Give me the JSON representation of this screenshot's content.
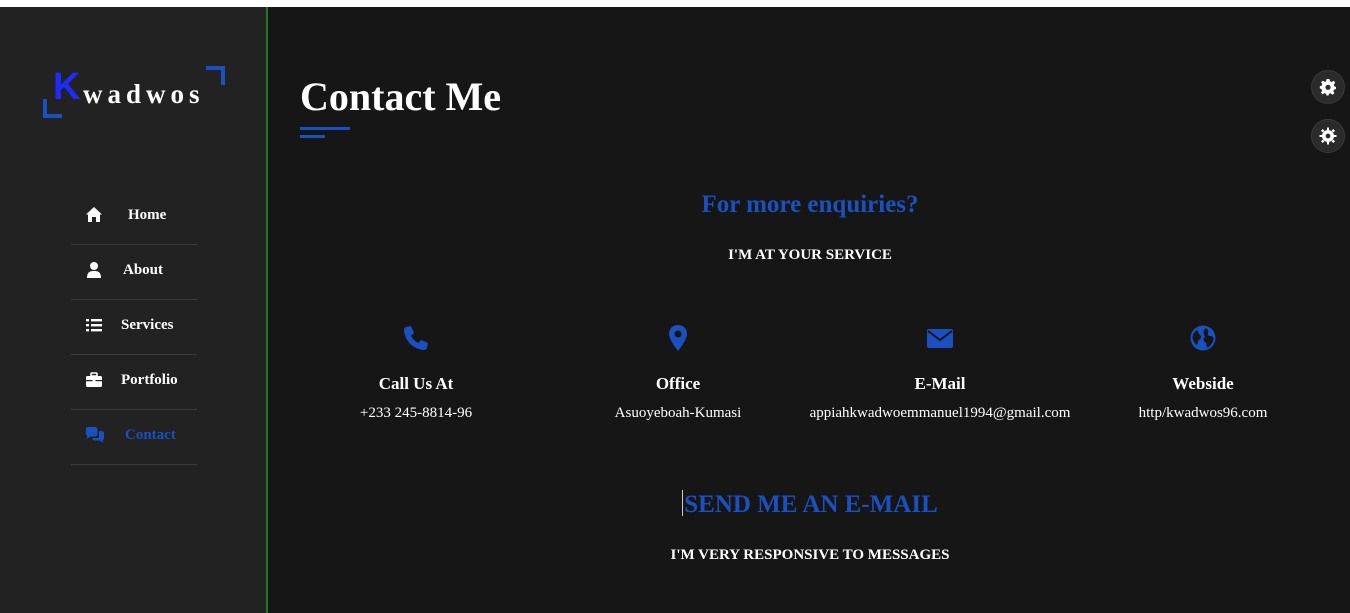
{
  "brand": {
    "first_letter": "K",
    "rest": "wadwos"
  },
  "nav": {
    "items": [
      {
        "label": "Home",
        "icon": "home-icon"
      },
      {
        "label": "About",
        "icon": "user-icon"
      },
      {
        "label": "Services",
        "icon": "list-icon"
      },
      {
        "label": "Portfolio",
        "icon": "briefcase-icon"
      },
      {
        "label": "Contact",
        "icon": "comments-icon",
        "active": true
      }
    ]
  },
  "page": {
    "title": "Contact Me",
    "enquiry_title": "For more enquiries?",
    "enquiry_subtitle": "I'M AT YOUR SERVICE",
    "send_title": "SEND ME AN E-MAIL",
    "send_subtitle": "I'M VERY RESPONSIVE TO MESSAGES"
  },
  "contact_info": [
    {
      "icon": "phone-icon",
      "title": "Call Us At",
      "value": "+233 245-8814-96"
    },
    {
      "icon": "map-pin-icon",
      "title": "Office",
      "value": "Asuoyeboah-Kumasi"
    },
    {
      "icon": "envelope-icon",
      "title": "E-Mail",
      "value": "appiahkwadwoemmanuel1994@gmail.com"
    },
    {
      "icon": "globe-icon",
      "title": "Webside",
      "value": "http/kwadwos96.com"
    }
  ],
  "colors": {
    "accent": "#1a50c0",
    "background": "#161616",
    "sidebar": "#222222",
    "sidebar_border": "#1f7a1f",
    "logo_k": "#1e2bff"
  },
  "settings_buttons": [
    "gear-icon",
    "cog-icon"
  ]
}
